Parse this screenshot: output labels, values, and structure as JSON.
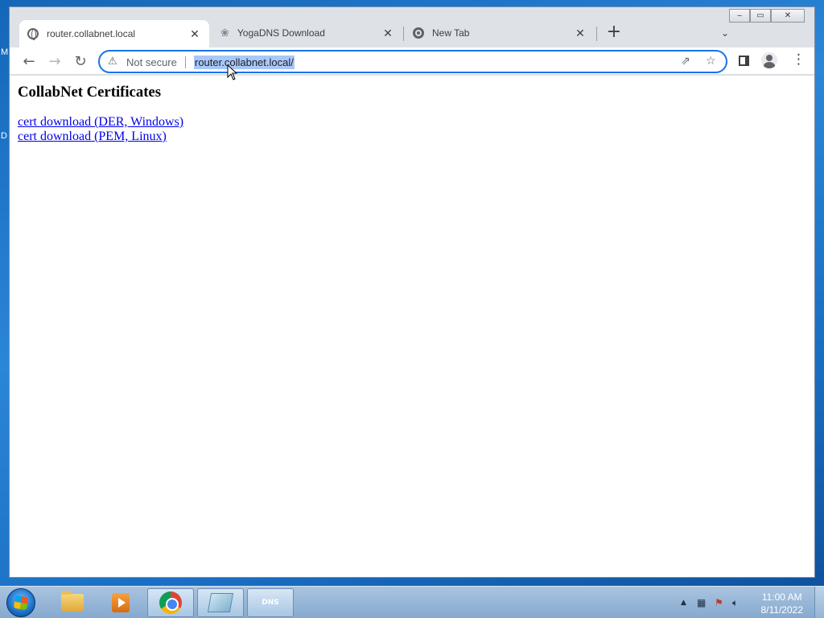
{
  "desktop": {
    "edge_labels": [
      "M",
      "D"
    ]
  },
  "window": {
    "controls": {
      "minimize": "‒",
      "maximize": "▭",
      "close": "✕"
    }
  },
  "tabs": [
    {
      "title": "router.collabnet.local",
      "icon": "globe-icon",
      "active": true
    },
    {
      "title": "YogaDNS Download",
      "icon": "lotus-icon",
      "active": false
    },
    {
      "title": "New Tab",
      "icon": "chrome-icon",
      "active": false
    }
  ],
  "tab_close_glyph": "✕",
  "new_tab_glyph": "+",
  "tab_menu_glyph": "⌄",
  "toolbar": {
    "back_glyph": "←",
    "forward_glyph": "→",
    "reload_glyph": "↻",
    "security_label": "Not secure",
    "url": "router.collabnet.local/",
    "share_glyph": "⇗",
    "star_glyph": "☆",
    "menu_glyph": "⋮"
  },
  "page": {
    "title": "CollabNet Certificates",
    "links": [
      "cert download (DER, Windows)",
      "cert download (PEM, Linux)"
    ]
  },
  "taskbar": {
    "dns_label": "DNS",
    "tray": {
      "expand_glyph": "▲",
      "clock_time": "11:00 AM",
      "clock_date": "8/11/2022"
    }
  },
  "colors": {
    "accent": "#1a73e8",
    "link": "#0000ee",
    "url_highlight": "#a8c7fa"
  }
}
